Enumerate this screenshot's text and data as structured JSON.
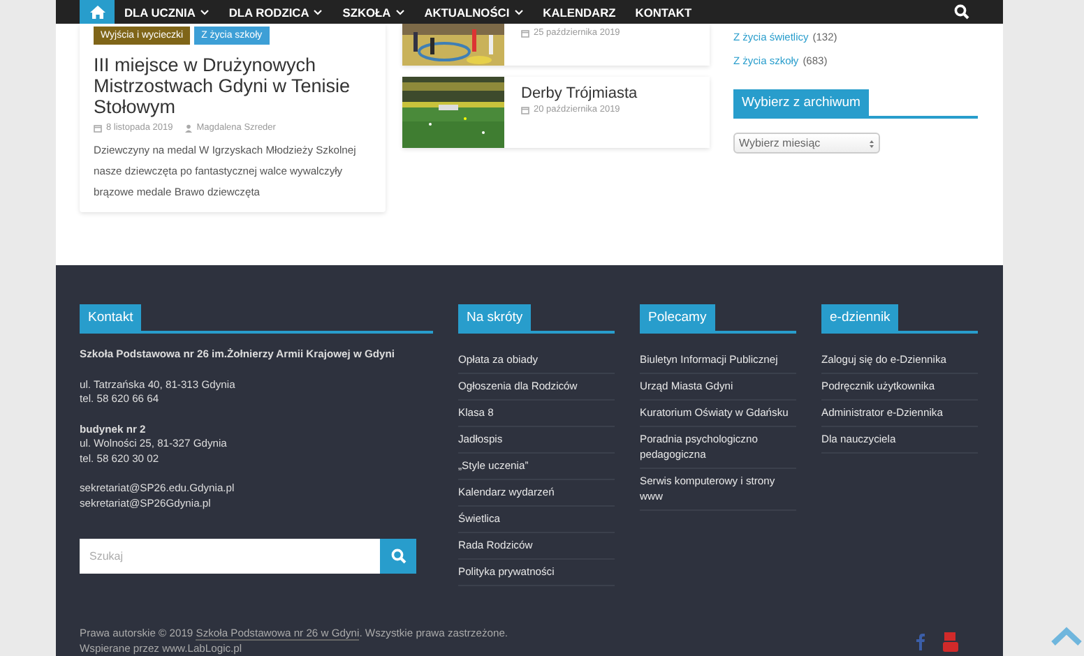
{
  "nav": {
    "home_selected": true,
    "items": [
      {
        "label": "DLA UCZNIA",
        "dropdown": true
      },
      {
        "label": "DLA RODZICA",
        "dropdown": true
      },
      {
        "label": "SZKOŁA",
        "dropdown": true
      },
      {
        "label": "AKTUALNOŚCI",
        "dropdown": true
      },
      {
        "label": "KALENDARZ",
        "dropdown": false
      },
      {
        "label": "KONTAKT",
        "dropdown": false
      }
    ]
  },
  "featured_post": {
    "categories": [
      {
        "label": "Wyjścia i wycieczki",
        "color": "#7f6518"
      },
      {
        "label": "Z życia szkoły",
        "color": "#3d9fd6"
      }
    ],
    "title": "III miejsce w Drużynowych Mistrzostwach Gdyni w Tenisie Stołowym",
    "date": "8 listopada 2019",
    "author": "Magdalena Szreder",
    "excerpt": "Dziewczyny na medal W Igrzyskach Młodzieży Szkolnej nasze dziewczęta po fantastycznej walce wywalczyły brązowe medale Brawo dziewczęta"
  },
  "posts": [
    {
      "date": "25 października 2019"
    },
    {
      "title": "Derby Trójmiasta",
      "date": "20 października 2019"
    }
  ],
  "sidebar": {
    "categories": [
      {
        "name": "Z życia świetlicy",
        "count": "(132)"
      },
      {
        "name": "Z życia szkoły",
        "count": "(683)"
      }
    ],
    "archive": {
      "heading": "Wybierz z archiwum",
      "select": "Wybierz miesiąc"
    }
  },
  "footer": {
    "contact": {
      "heading": "Kontakt",
      "blocks": [
        {
          "title": "Szkoła Podstawowa nr 26 im.Żołnierzy Armii Krajowej w Gdyni"
        },
        {
          "lines": [
            "ul. Tatrzańska 40, 81-313 Gdynia",
            "tel. 58 620 66 64"
          ]
        },
        {
          "title": "budynek nr 2",
          "lines": [
            "ul. Wolności 25, 81-327 Gdynia",
            "tel. 58 620 30 02"
          ]
        },
        {
          "lines": [
            "sekretariat@SP26.edu.Gdynia.pl",
            "sekretariat@SP26Gdynia.pl"
          ]
        }
      ],
      "search_placeholder": "Szukaj"
    },
    "link_columns": [
      {
        "heading": "Na skróty",
        "links": [
          "Opłata za obiady",
          "Ogłoszenia dla Rodziców",
          "Klasa 8",
          "Jadłospis",
          "„Style uczenia”",
          "Kalendarz wydarzeń",
          "Świetlica",
          "Rada Rodziców",
          "Polityka prywatności"
        ]
      },
      {
        "heading": "Polecamy",
        "links": [
          "Biuletyn Informacji Publicznej",
          "Urząd Miasta Gdyni",
          "Kuratorium Oświaty w Gdańsku",
          "Poradnia psychologiczno pedagogiczna",
          "Serwis komputerowy i strony www"
        ]
      },
      {
        "heading": "e-dziennik",
        "links": [
          "Zaloguj się do e-Dziennika",
          "Podręcznik użytkownika",
          "Administrator e-Dziennika",
          "Dla nauczyciela"
        ]
      }
    ],
    "copyright": {
      "before": "Prawa autorskie © 2019 ",
      "link": "Szkoła Podstawowa nr 26 w Gdyni",
      "after": ". Wszystkie prawa zastrzeżone."
    },
    "powered_by": "Wspierane przez www.LabLogic.pl"
  }
}
